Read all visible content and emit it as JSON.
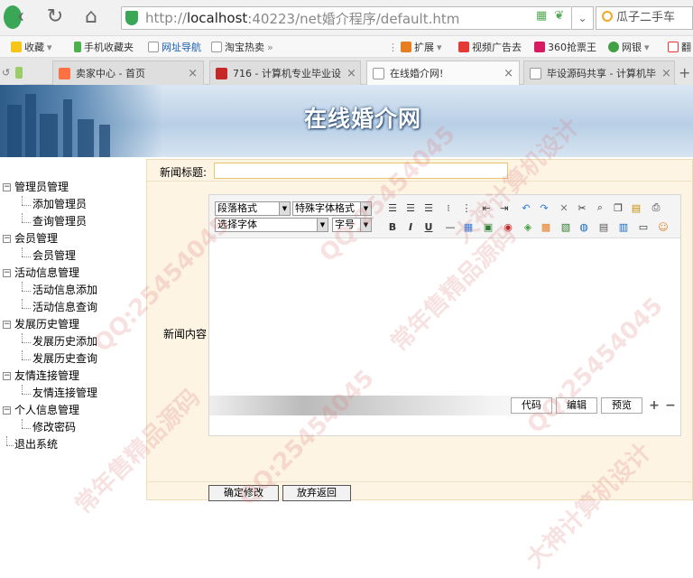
{
  "browser": {
    "url_scheme": "http://",
    "url_host": "localhost",
    "url_rest": ":40223/net婚介程序/default.htm",
    "search_text": "瓜子二手车",
    "bookmarks": [
      "收藏",
      "手机收藏夹",
      "网址导航",
      "淘宝热卖",
      "扩展",
      "视频广告去",
      "360抢票王",
      "网银",
      "翻"
    ],
    "tabs": [
      "卖家中心 - 首页",
      "716 - 计算机专业毕业设",
      "在线婚介网!",
      "毕设源码共享 - 计算机毕"
    ],
    "active_tab": 2
  },
  "site": {
    "title": "在线婚介网"
  },
  "sidebar": {
    "groups": [
      {
        "label": "管理员管理",
        "children": [
          "添加管理员",
          "查询管理员"
        ]
      },
      {
        "label": "会员管理",
        "children": [
          "会员管理"
        ]
      },
      {
        "label": "活动信息管理",
        "children": [
          "活动信息添加",
          "活动信息查询"
        ]
      },
      {
        "label": "发展历史管理",
        "children": [
          "发展历史添加",
          "发展历史查询"
        ]
      },
      {
        "label": "友情连接管理",
        "children": [
          "友情连接管理"
        ]
      },
      {
        "label": "个人信息管理",
        "children": [
          "修改密码"
        ]
      }
    ],
    "logout": "退出系统"
  },
  "form": {
    "title_label": "新闻标题:",
    "title_value": "",
    "content_label": "新闻内容",
    "selects": {
      "paragraph": "段落格式",
      "special": "特殊字体格式",
      "font": "选择字体",
      "size": "字号"
    },
    "modes": [
      "代码",
      "编辑",
      "预览"
    ],
    "submit": "确定修改",
    "cancel": "放弃返回"
  },
  "watermark": {
    "qq": "QQ:25454045",
    "a": "大神计算机设计",
    "b": "常年售精品源码"
  }
}
